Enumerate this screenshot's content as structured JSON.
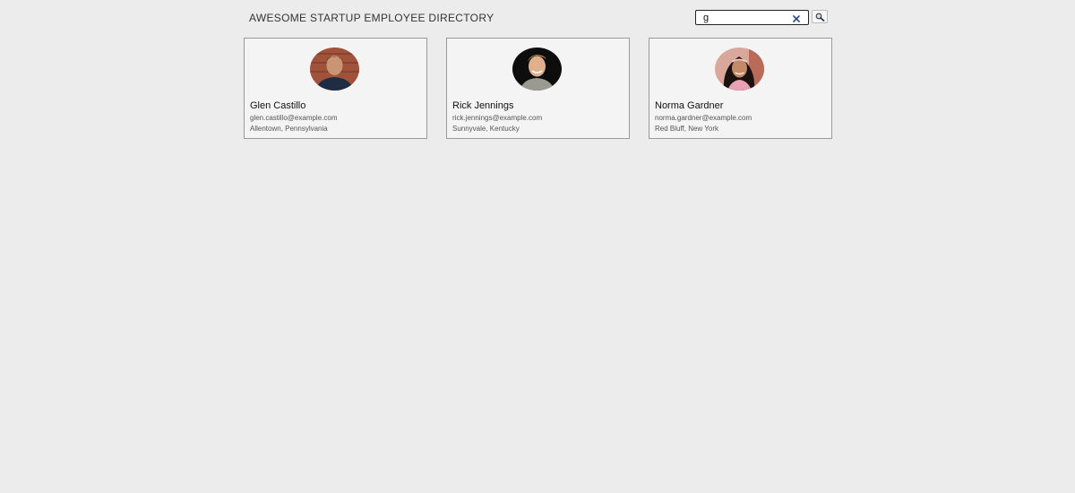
{
  "header": {
    "title": "AWESOME STARTUP EMPLOYEE DIRECTORY"
  },
  "search": {
    "value": "g",
    "clear_icon": "close-icon",
    "button_icon": "search-icon"
  },
  "employees": [
    {
      "name": "Glen Castillo",
      "email": "glen.castillo@example.com",
      "location": "Allentown, Pennsylvania",
      "avatar_icon": "avatar-photo"
    },
    {
      "name": "Rick Jennings",
      "email": "rick.jennings@example.com",
      "location": "Sunnyvale, Kentucky",
      "avatar_icon": "avatar-photo"
    },
    {
      "name": "Norma Gardner",
      "email": "norma.gardner@example.com",
      "location": "Red Bluff, New York",
      "avatar_icon": "avatar-photo"
    }
  ]
}
